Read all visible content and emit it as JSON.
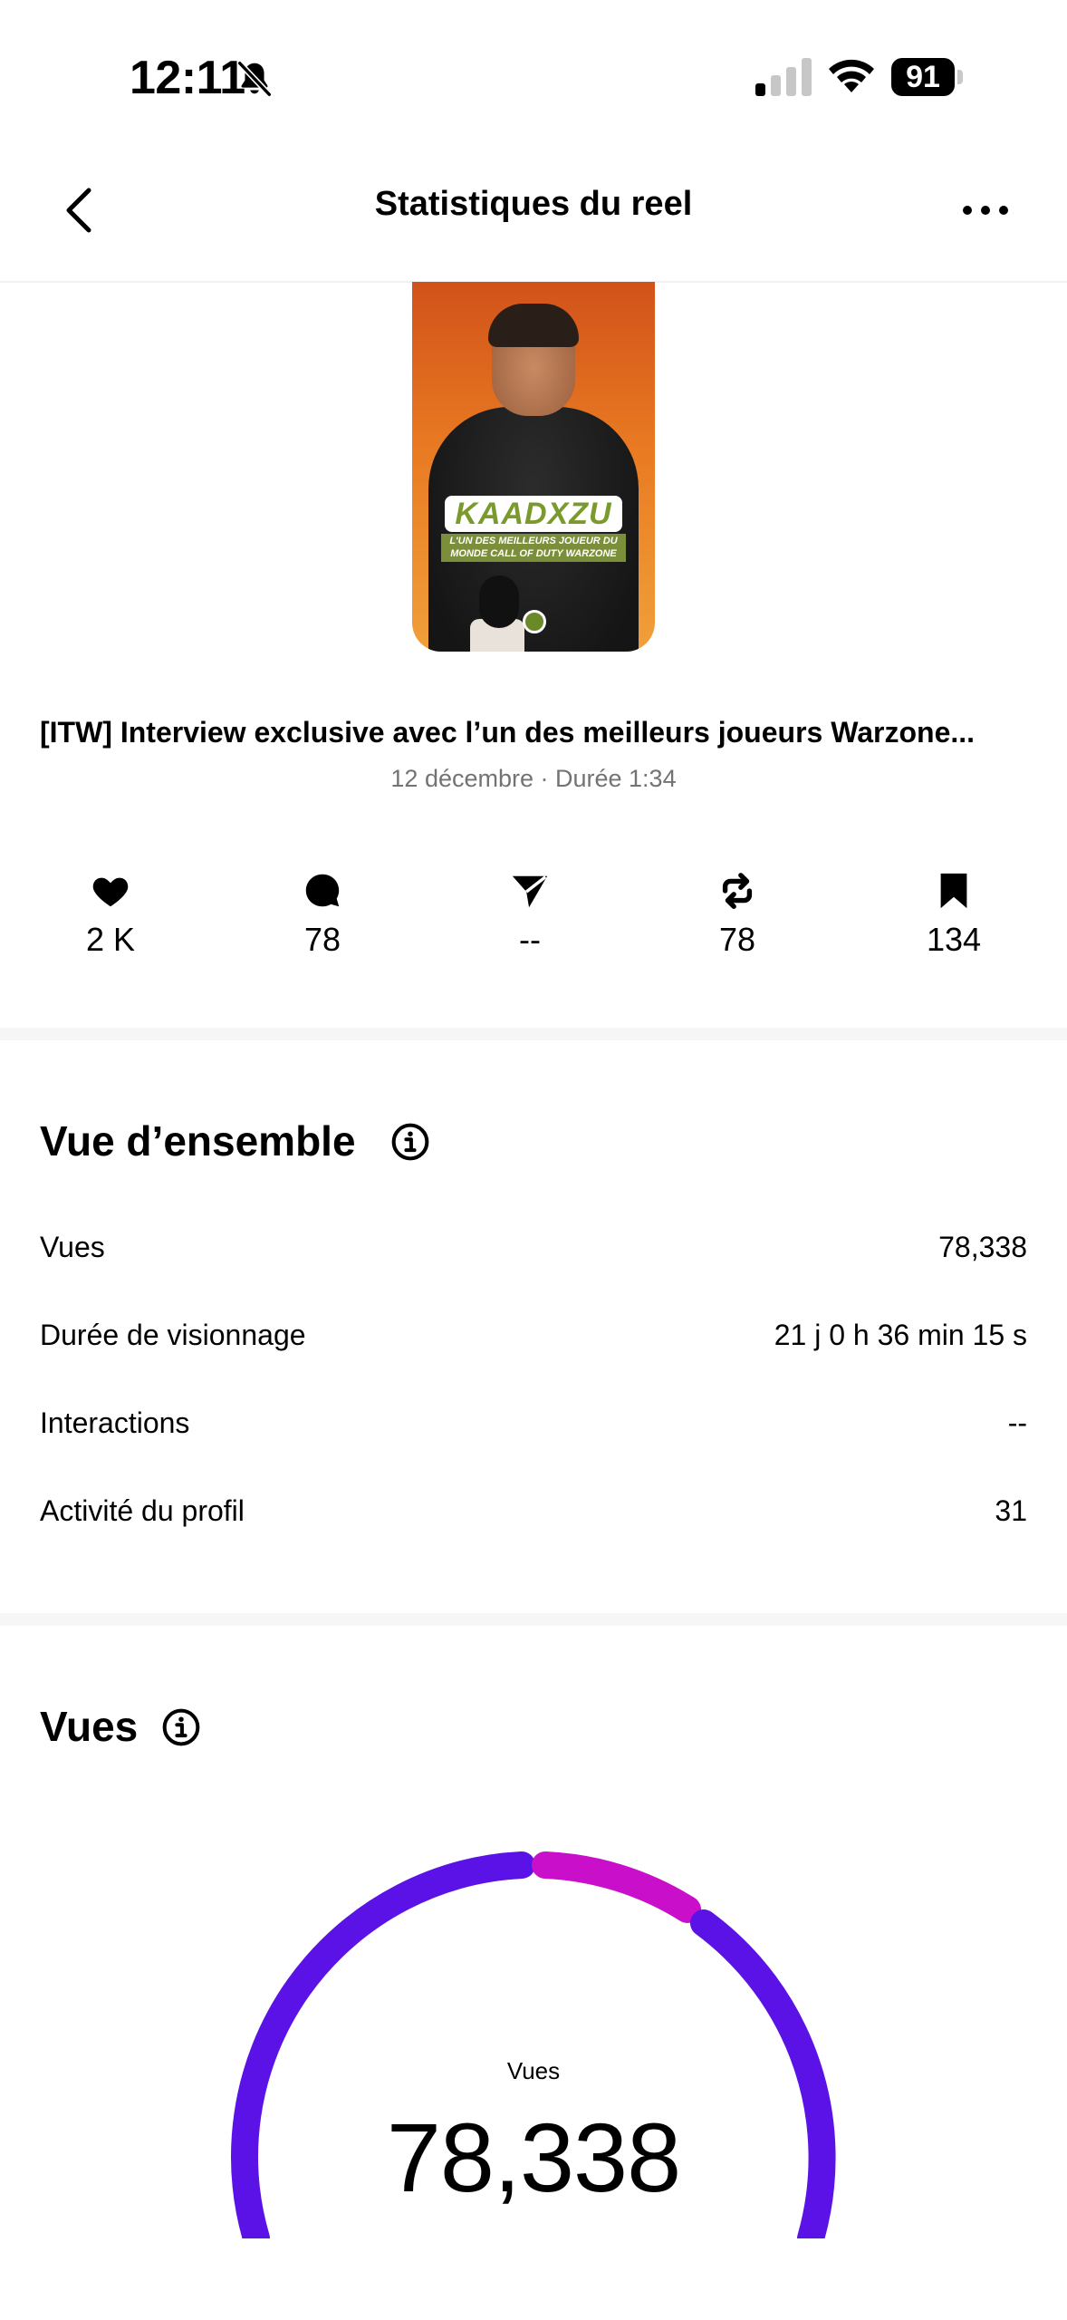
{
  "status_bar": {
    "time": "12:11",
    "battery": "91",
    "icons": [
      "bell-off-icon",
      "signal-icon",
      "wifi-icon",
      "battery-icon"
    ]
  },
  "nav": {
    "title": "Statistiques du reel",
    "back_icon": "chevron-left-icon",
    "more_icon": "more-horizontal-icon"
  },
  "reel": {
    "thumbnail_name": "KAADXZU",
    "thumbnail_subtitle": "L'UN DES MEILLEURS JOUEUR DU MONDE CALL OF DUTY WARZONE",
    "title": "[ITW] Interview exclusive avec l’un des meilleurs joueurs Warzone...",
    "meta": "12 décembre · Durée 1:34"
  },
  "stats": [
    {
      "icon": "heart-icon",
      "value": "2 K"
    },
    {
      "icon": "comment-icon",
      "value": "78"
    },
    {
      "icon": "share-icon",
      "value": "--"
    },
    {
      "icon": "repost-icon",
      "value": "78"
    },
    {
      "icon": "bookmark-icon",
      "value": "134"
    }
  ],
  "overview": {
    "title": "Vue d’ensemble",
    "rows": [
      {
        "label": "Vues",
        "value": "78,338"
      },
      {
        "label": "Durée de visionnage",
        "value": "21 j 0 h 36 min 15 s"
      },
      {
        "label": "Interactions",
        "value": "--"
      },
      {
        "label": "Activité du profil",
        "value": "31"
      }
    ]
  },
  "views": {
    "title": "Vues",
    "gauge_label": "Vues",
    "gauge_value": "78,338",
    "colors": {
      "primary": "#5b12e6",
      "secondary": "#c90fc9"
    }
  }
}
